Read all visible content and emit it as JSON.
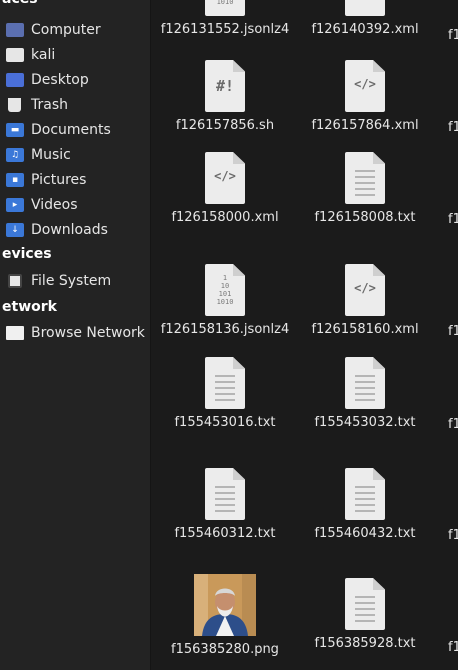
{
  "sidebar": {
    "places_head": "aces",
    "places": [
      {
        "label": "Computer",
        "icon": "computer-icon"
      },
      {
        "label": "kali",
        "icon": "home-folder-icon"
      },
      {
        "label": "Desktop",
        "icon": "desktop-folder-icon"
      },
      {
        "label": "Trash",
        "icon": "trash-icon"
      },
      {
        "label": "Documents",
        "icon": "documents-folder-icon"
      },
      {
        "label": "Music",
        "icon": "music-folder-icon"
      },
      {
        "label": "Pictures",
        "icon": "pictures-folder-icon"
      },
      {
        "label": "Videos",
        "icon": "videos-folder-icon"
      },
      {
        "label": "Downloads",
        "icon": "downloads-folder-icon"
      }
    ],
    "devices_head": "evices",
    "devices": [
      {
        "label": "File System",
        "icon": "drive-icon"
      }
    ],
    "network_head": "etwork",
    "network": [
      {
        "label": "Browse Network",
        "icon": "network-icon"
      }
    ]
  },
  "files": {
    "col1": [
      {
        "name": "f126131552.jsonlz4",
        "type": "binary"
      },
      {
        "name": "f126157856.sh",
        "type": "script"
      },
      {
        "name": "f126158000.xml",
        "type": "xml"
      },
      {
        "name": "f126158136.jsonlz4",
        "type": "binary"
      },
      {
        "name": "f155453016.txt",
        "type": "text"
      },
      {
        "name": "f155460312.txt",
        "type": "text"
      },
      {
        "name": "f156385280.png",
        "type": "image"
      }
    ],
    "col2": [
      {
        "name": "f126140392.xml",
        "type": "xml"
      },
      {
        "name": "f126157864.xml",
        "type": "xml"
      },
      {
        "name": "f126158008.txt",
        "type": "text"
      },
      {
        "name": "f126158160.xml",
        "type": "xml"
      },
      {
        "name": "f155453032.txt",
        "type": "text"
      },
      {
        "name": "f155460432.txt",
        "type": "text"
      },
      {
        "name": "f156385928.txt",
        "type": "text"
      }
    ],
    "col3_partial": [
      "f1",
      "f1",
      "f1",
      "f1",
      "f1",
      "f1",
      "f1"
    ]
  },
  "icon_glyphs": {
    "script": "#!",
    "xml": "</>",
    "binary": "1\n10\n101\n1010"
  }
}
